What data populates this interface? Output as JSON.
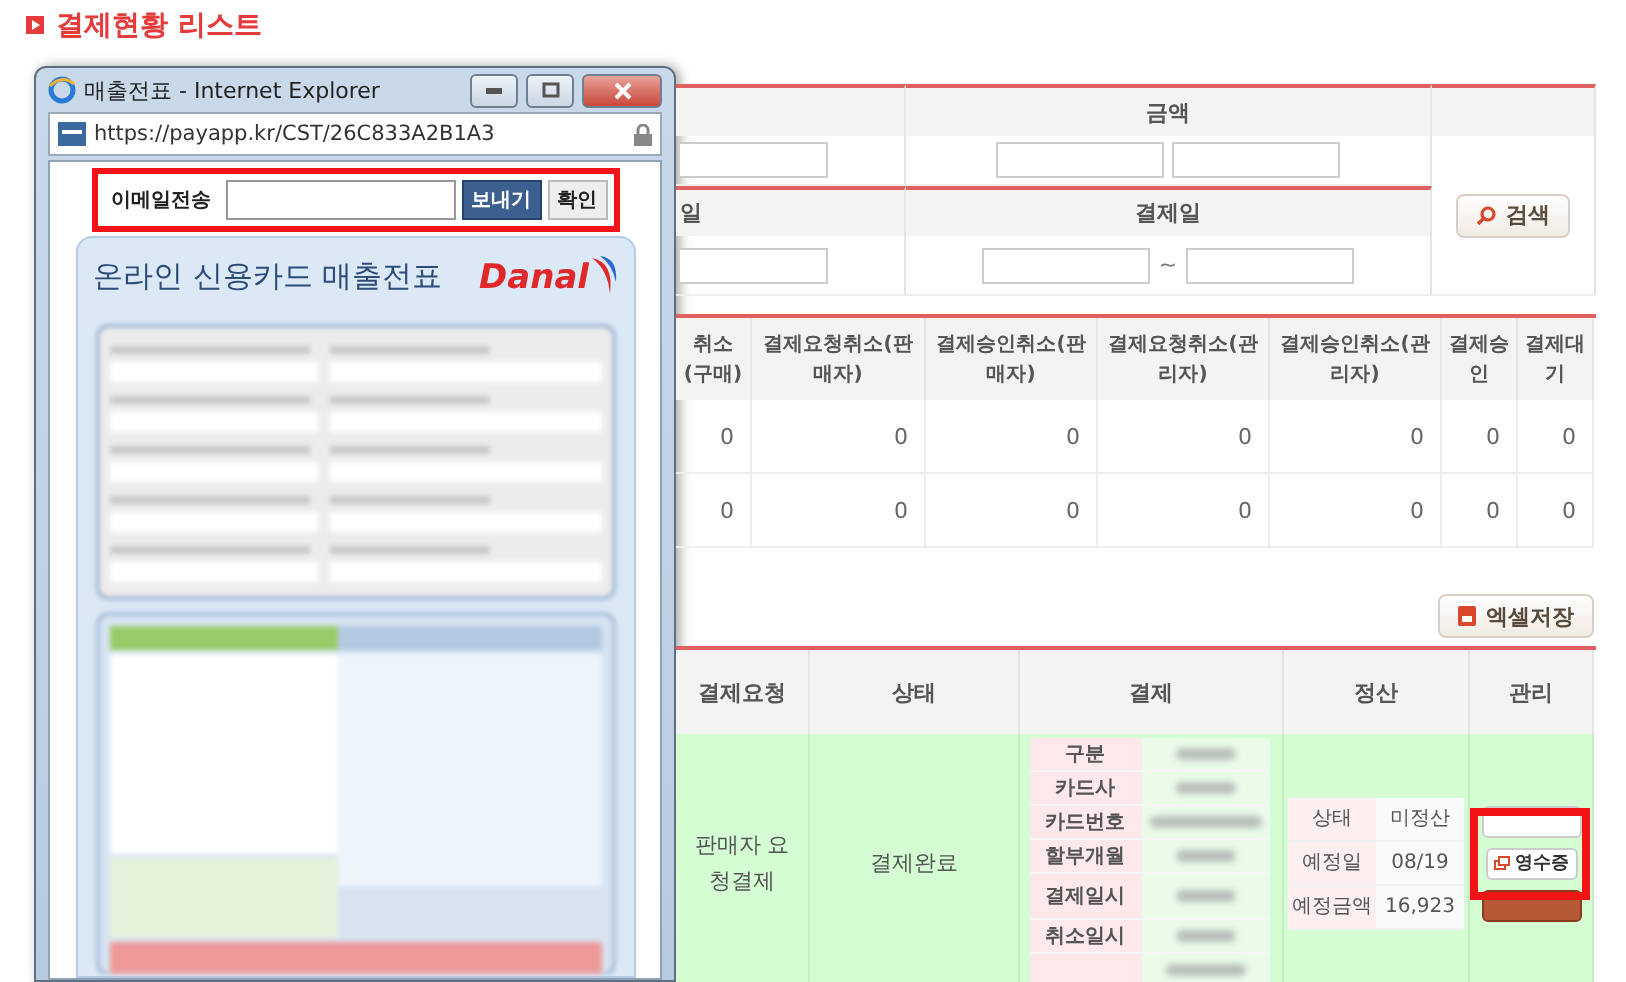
{
  "page_title": "결제현황 리스트",
  "popup": {
    "title": "매출전표 - Internet Explorer",
    "address": "https://payapp.kr/CST/26C833A2B1A3",
    "email_label": "이메일전송",
    "send_button": "보내기",
    "confirm_button": "확인",
    "receipt_title": "온라인 신용카드 매출전표",
    "brand": "Danal"
  },
  "search": {
    "amount_label": "금액",
    "date_label_partial": "일",
    "payment_date_label": "결제일",
    "date_separator": "~",
    "button": "검색"
  },
  "stats": {
    "columns": [
      "취소(구매)",
      "결제요청취소(판매자)",
      "결제승인취소(판매자)",
      "결제요청취소(관리자)",
      "결제승인취소(관리자)",
      "결제승인",
      "결제대기"
    ],
    "rows": [
      [
        "0",
        "0",
        "0",
        "0",
        "0",
        "0",
        "0"
      ],
      [
        "0",
        "0",
        "0",
        "0",
        "0",
        "0",
        "0"
      ]
    ]
  },
  "excel_button": "엑셀저장",
  "list": {
    "columns": [
      "결제요청",
      "상태",
      "결제",
      "정산",
      "관리"
    ],
    "rows": [
      {
        "request": "판매자 요청결제",
        "status": "결제완료",
        "payment_labels": [
          "구분",
          "카드사",
          "카드번호",
          "할부개월",
          "결제일시",
          "취소일시"
        ],
        "settlement": [
          {
            "label": "상태",
            "value": "미정산"
          },
          {
            "label": "예정일",
            "value": "08/19"
          },
          {
            "label": "예정금액",
            "value": "16,923"
          }
        ],
        "receipt_button": "영수증"
      }
    ]
  }
}
